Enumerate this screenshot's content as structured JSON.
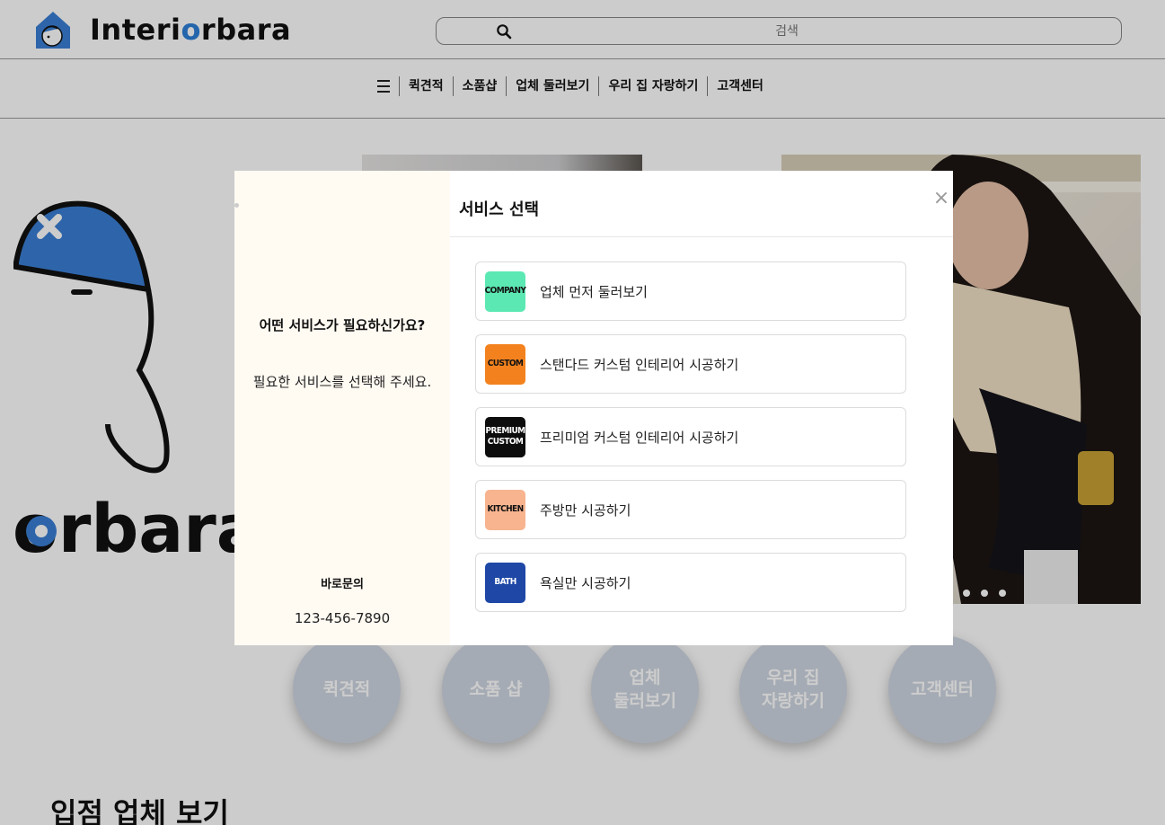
{
  "header": {
    "logo_text_pre": "Interi",
    "logo_text_o": "o",
    "logo_text_post": "rbara",
    "search_placeholder": "검색"
  },
  "nav": {
    "items": [
      "퀵견적",
      "소품샵",
      "업체 둘러보기",
      "우리 집 자랑하기",
      "고객센터"
    ]
  },
  "hero": {
    "logo_word": "ɵrbara"
  },
  "circles": [
    {
      "line1": "퀵견적",
      "line2": ""
    },
    {
      "line1": "소품 샵",
      "line2": ""
    },
    {
      "line1": "업체",
      "line2": "둘러보기"
    },
    {
      "line1": "우리 집",
      "line2": "자랑하기"
    },
    {
      "line1": "고객센터",
      "line2": ""
    }
  ],
  "section_title": "입점 업체 보기",
  "modal": {
    "title": "서비스 선택",
    "close": "×",
    "side": {
      "question": "어떤 서비스가 필요하신가요?",
      "description": "필요한 서비스를 선택해 주세요.",
      "direct_label": "바로문의",
      "phone": "123-456-7890"
    },
    "services": [
      {
        "badge_line1": "COMPANY",
        "badge_line2": "",
        "badge_color": "#5ce8b3",
        "badge_text_color": "#111111",
        "label": "업체 먼저 둘러보기"
      },
      {
        "badge_line1": "CUSTOM",
        "badge_line2": "",
        "badge_color": "#f3821e",
        "badge_text_color": "#111111",
        "label": "스탠다드 커스텀 인테리어 시공하기"
      },
      {
        "badge_line1": "PREMIUM",
        "badge_line2": "CUSTOM",
        "badge_color": "#0d0d0d",
        "badge_text_color": "#ffffff",
        "label": "프리미엄 커스텀 인테리어 시공하기"
      },
      {
        "badge_line1": "KITCHEN",
        "badge_line2": "",
        "badge_color": "#f7b48f",
        "badge_text_color": "#111111",
        "label": "주방만 시공하기"
      },
      {
        "badge_line1": "BATH",
        "badge_line2": "",
        "badge_color": "#1e47a6",
        "badge_text_color": "#ffffff",
        "label": "욕실만 시공하기"
      }
    ]
  },
  "colors": {
    "brand_blue": "#2e7fd8",
    "overlay": "rgba(0,0,0,0.2)",
    "modal_side_bg": "#fffaf2"
  }
}
